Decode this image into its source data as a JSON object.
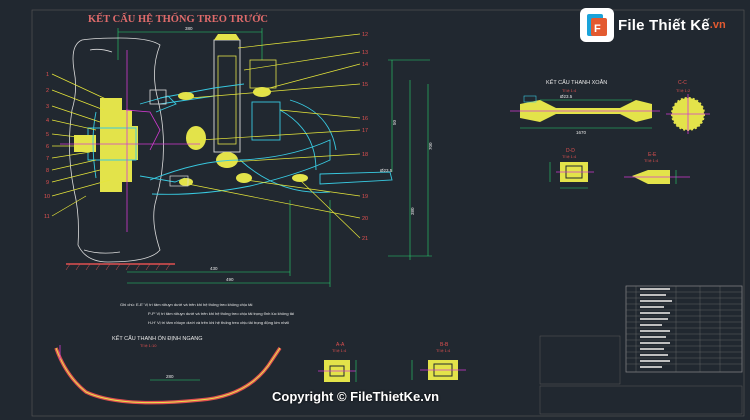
{
  "drawing": {
    "main_title": "KẾT CẤU HỆ THỐNG TREO TRƯỚC",
    "torsion_title": "KẾT CẤU THANH XOẮN",
    "torsion_scale": "Tỉ lệ 1:4",
    "section_cc": "C-C",
    "section_cc_scale": "Tỉ lệ 1:2",
    "section_dd": "D-D",
    "section_dd_scale": "Tỉ lệ 1:4",
    "section_ee": "E-E",
    "section_ee_scale": "Tỉ lệ 1:4",
    "stabilizer_title": "KẾT CẤU THANH ỔN ĐỊNH NGANG",
    "stabilizer_scale": "Tỉ lệ 1:10",
    "section_aa": "A-A",
    "section_aa_scale": "Tỉ lệ 1:4",
    "section_bb": "B-B",
    "section_bb_scale": "Tỉ lệ 1:4",
    "notes": [
      "Ghi chú: E-E' Vị trí tâm rôtuyn dưới và trên khi hệ thống treo không chịu tải",
      "P-P' Vị trí tâm rôtuyn dưới và trên khi hệ thống treo chịu tải trọng tĩnh lúc không tải",
      "H-H' Vị trí tâm rôtuyn dưới và trên khi hệ thống treo chịu tải trọng động lớn nhất"
    ],
    "dims": {
      "top_width": "380",
      "bottom_inner": "430",
      "bottom_outer": "490",
      "height_a": "50",
      "height_b": "700",
      "height_c": "380",
      "bar_length": "1670",
      "bar_diameter": "Ø23.5",
      "stab_width": "280"
    },
    "left_labels": [
      "1",
      "2",
      "3",
      "4",
      "5",
      "6",
      "7",
      "8",
      "9",
      "10",
      "11"
    ],
    "right_labels": [
      "12",
      "13",
      "14",
      "15",
      "16",
      "17",
      "18",
      "19",
      "20",
      "21"
    ]
  },
  "branding": {
    "logo_text": "File Thiết Kế",
    "logo_domain": ".vn",
    "copyright": "Copyright © FileThietKe.vn"
  },
  "colors": {
    "background": "#212830",
    "accent_yellow": "#e3e34a",
    "accent_cyan": "#38c9e0",
    "accent_red": "#e05050",
    "accent_green": "#29d36f"
  }
}
